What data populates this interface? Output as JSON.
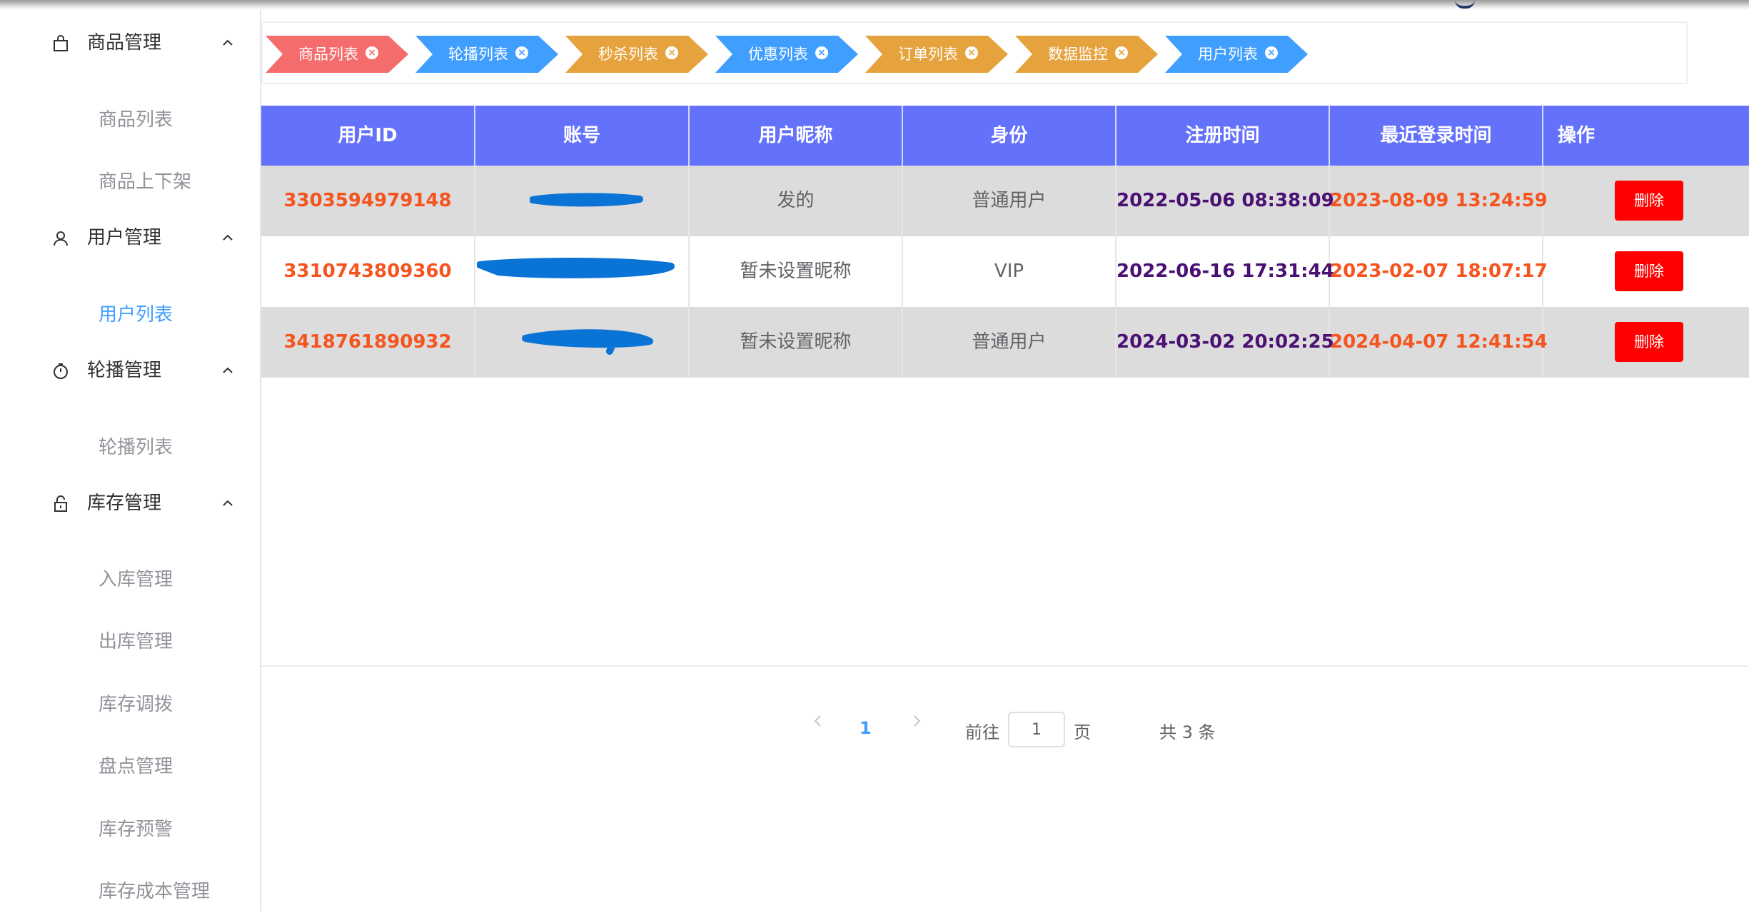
{
  "colors": {
    "accent": "#409eff",
    "table_header": "#6472fb",
    "delete_button": "#ff0000",
    "id_text": "#f5541f",
    "register_time_text": "#4b1073",
    "login_time_text": "#f5541f",
    "tab_red": "#f56c6c",
    "tab_blue": "#409eff",
    "tab_orange": "#e6a23c",
    "redaction": "#0a74d6"
  },
  "sidebar": {
    "groups": [
      {
        "label": "商品管理",
        "icon": "bag-icon",
        "items": [
          {
            "label": "商品列表"
          },
          {
            "label": "商品上下架"
          }
        ]
      },
      {
        "label": "用户管理",
        "icon": "user-icon",
        "items": [
          {
            "label": "用户列表",
            "active": true
          }
        ]
      },
      {
        "label": "轮播管理",
        "icon": "timer-icon",
        "items": [
          {
            "label": "轮播列表"
          }
        ]
      },
      {
        "label": "库存管理",
        "icon": "lock-icon",
        "items": [
          {
            "label": "入库管理"
          },
          {
            "label": "出库管理"
          },
          {
            "label": "库存调拨"
          },
          {
            "label": "盘点管理"
          },
          {
            "label": "库存预警"
          },
          {
            "label": "库存成本管理"
          }
        ]
      }
    ]
  },
  "tabs": [
    {
      "label": "商品列表",
      "color": "#f56c6c"
    },
    {
      "label": "轮播列表",
      "color": "#409eff"
    },
    {
      "label": "秒杀列表",
      "color": "#e6a23c"
    },
    {
      "label": "优惠列表",
      "color": "#409eff"
    },
    {
      "label": "订单列表",
      "color": "#e6a23c"
    },
    {
      "label": "数据监控",
      "color": "#e6a23c"
    },
    {
      "label": "用户列表",
      "color": "#409eff"
    }
  ],
  "table": {
    "columns": [
      "用户ID",
      "账号",
      "用户昵称",
      "身份",
      "注册时间",
      "最近登录时间",
      "操作"
    ],
    "rows": [
      {
        "id": "3303594979148",
        "nickname": "发的",
        "role": "普通用户",
        "register_time": "2022-05-06 08:38:09",
        "last_login": "2023-08-09 13:24:59",
        "action": "删除"
      },
      {
        "id": "3310743809360",
        "nickname": "暂未设置昵称",
        "role": "VIP",
        "register_time": "2022-06-16 17:31:44",
        "last_login": "2023-02-07 18:07:17",
        "action": "删除"
      },
      {
        "id": "3418761890932",
        "nickname": "暂未设置昵称",
        "role": "普通用户",
        "register_time": "2024-03-02 20:02:25",
        "last_login": "2024-04-07 12:41:54",
        "action": "删除"
      }
    ]
  },
  "pagination": {
    "current_page": "1",
    "goto_prefix": "前往",
    "goto_value": "1",
    "goto_suffix": "页",
    "total": "共 3 条"
  }
}
